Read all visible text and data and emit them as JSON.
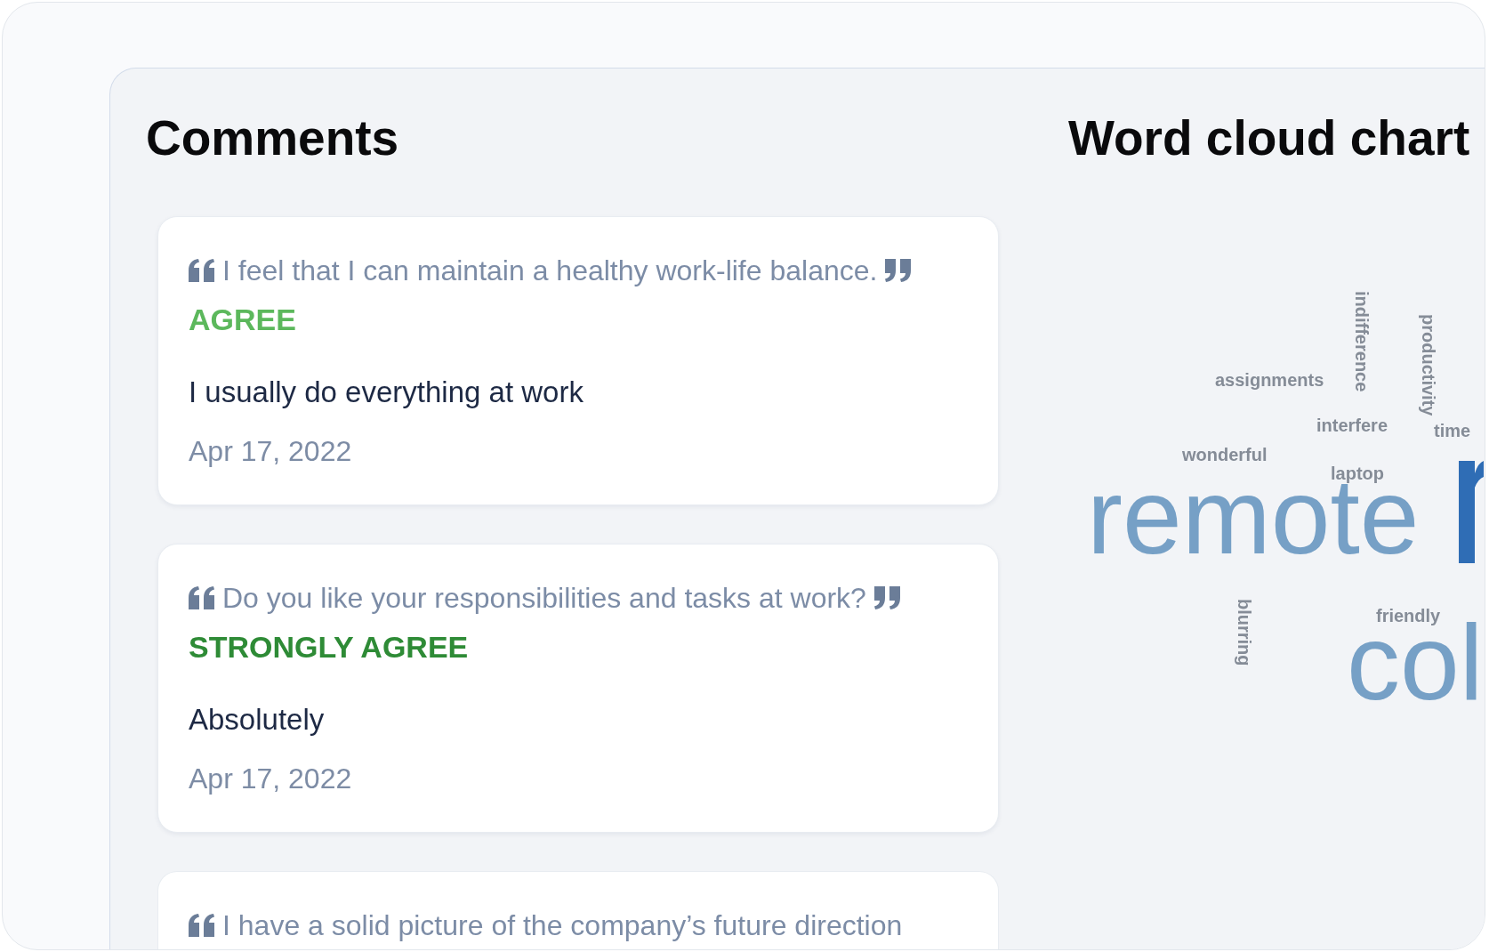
{
  "comments_panel": {
    "title": "Comments",
    "comments": [
      {
        "question": "I feel that I can maintain a healthy work-life balance.",
        "closing_quote": true,
        "rating": "AGREE",
        "color": "#5cb85c",
        "answer": "I usually do everything at work",
        "date": "Apr 17, 2022"
      },
      {
        "question": "Do you like your responsibilities and tasks at work?",
        "closing_quote": true,
        "rating": "STRONGLY AGREE",
        "color": "#2e8b36",
        "answer": "Absolutely",
        "date": "Apr 17, 2022"
      },
      {
        "question": "I have a solid picture of the company’s future direction",
        "closing_quote": false
      }
    ]
  },
  "word_cloud": {
    "title": "Word cloud chart",
    "words": [
      {
        "text": "indifference",
        "kind": "vertical"
      },
      {
        "text": "productivity",
        "kind": "vertical"
      },
      {
        "text": "assignments",
        "kind": "minor"
      },
      {
        "text": "interfere",
        "kind": "minor"
      },
      {
        "text": "time",
        "kind": "minor"
      },
      {
        "text": "wonderful",
        "kind": "minor"
      },
      {
        "text": "laptop",
        "kind": "minor"
      },
      {
        "text": "remote",
        "kind": "major"
      },
      {
        "text": "blurring",
        "kind": "vertical"
      },
      {
        "text": "friendly",
        "kind": "minor"
      },
      {
        "text": "col",
        "kind": "major"
      }
    ]
  }
}
